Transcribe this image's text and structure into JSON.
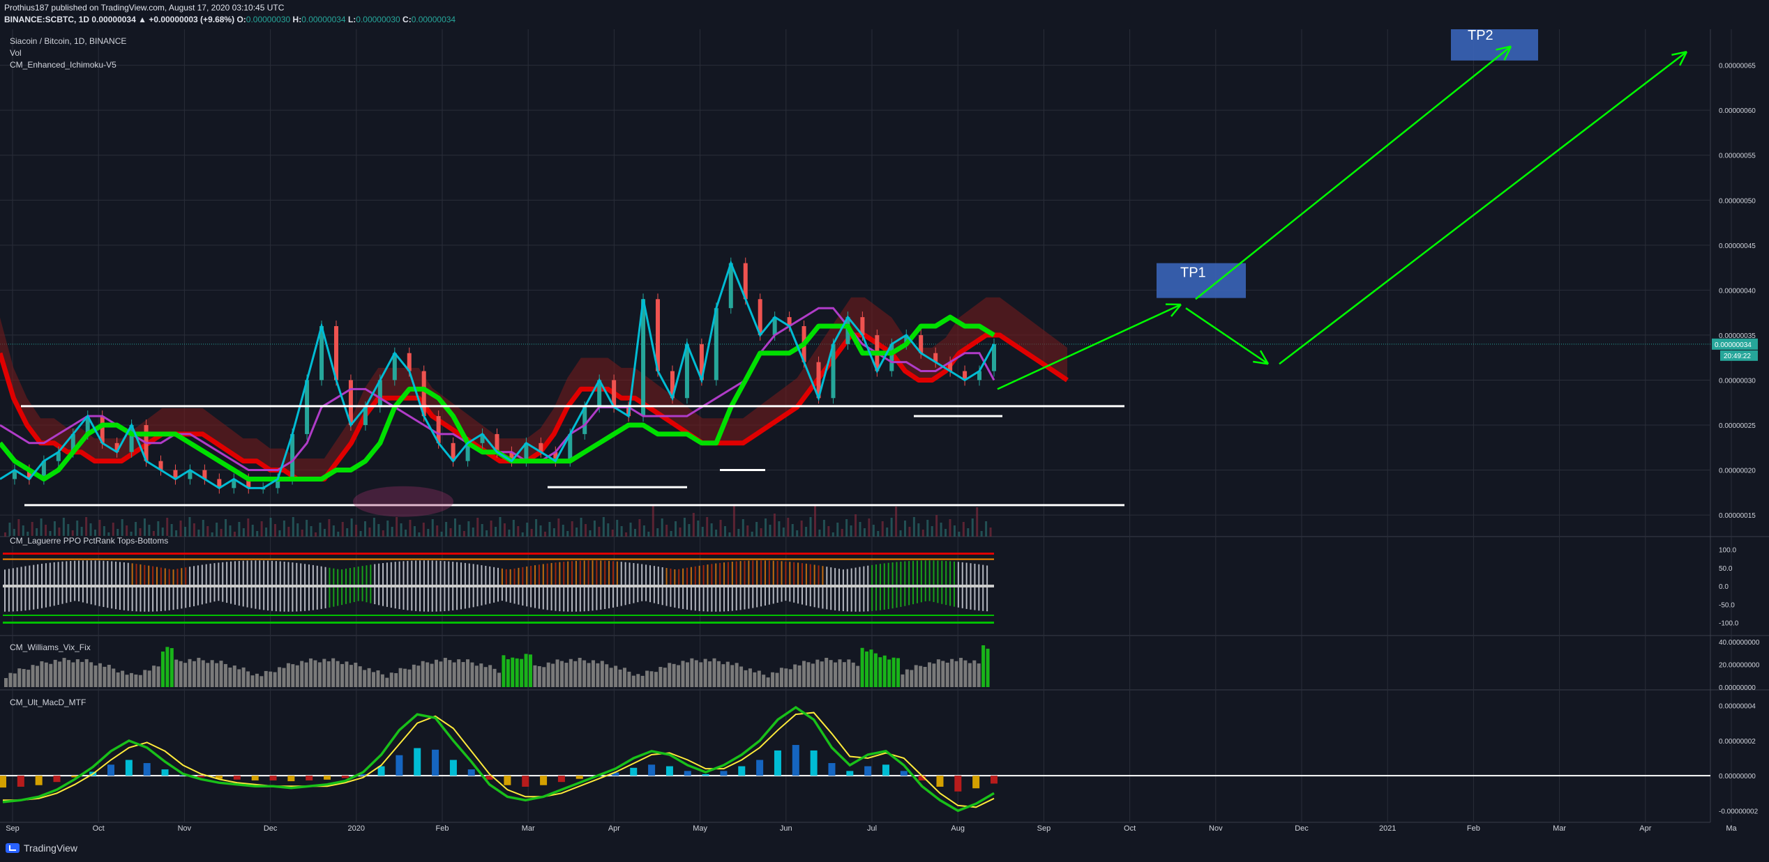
{
  "header": {
    "line1": "Prothius187 published on TradingView.com, August 17, 2020 03:10:45 UTC",
    "symbol": "BINANCE:SCBTC, 1D",
    "price": "0.00000034",
    "change": "▲ +0.00000003 (+9.68%)",
    "o_label": "O:",
    "o": "0.00000030",
    "h_label": "H:",
    "h": "0.00000034",
    "l_label": "L:",
    "l": "0.00000030",
    "c_label": "C:",
    "c": "0.00000034"
  },
  "legend": {
    "title": "Siacoin / Bitcoin, 1D, BINANCE",
    "vol": "Vol",
    "indicator": "CM_Enhanced_Ichimoku-V5"
  },
  "panes": {
    "laguerre": "CM_Laguerre PPO PctRank Tops-Bottoms",
    "vix": "CM_Williams_Vix_Fix",
    "macd": "CM_Ult_MacD_MTF"
  },
  "footer": {
    "brand": "TradingView",
    "icon": "tradingview-logo-icon"
  },
  "colors": {
    "background": "#131722",
    "grid": "#2a2e39",
    "price_line": "#26a69a",
    "tenkan": "#00bcd4",
    "kijun": "#00e000",
    "chikou": "#b03cc8",
    "cloud_bear": "#e00000",
    "annotation": "#00ff00",
    "tp_box": "#3a64b8"
  },
  "chart_data": [
    {
      "type": "line",
      "pane": "price",
      "ylabel": "",
      "ylim": [
        1.4e-07,
        6.9e-07
      ],
      "yticks": [
        "0.00000065",
        "0.00000060",
        "0.00000055",
        "0.00000050",
        "0.00000045",
        "0.00000040",
        "0.00000035",
        "0.00000030",
        "0.00000025",
        "0.00000020",
        "0.00000015"
      ],
      "xticks": [
        "Sep",
        "Oct",
        "Nov",
        "Dec",
        "2020",
        "Feb",
        "Mar",
        "Apr",
        "May",
        "Jun",
        "Jul",
        "Aug",
        "Sep",
        "Oct",
        "Nov",
        "Dec",
        "2021",
        "Feb",
        "Mar",
        "Apr",
        "Ma"
      ],
      "last_price": "0.00000034",
      "countdown": "20:49:22",
      "series": [
        {
          "values": [
            1.9e-07,
            2e-07,
            1.9e-07,
            2.1e-07,
            2.2e-07,
            2.4e-07,
            2.6e-07,
            2.3e-07,
            2.2e-07,
            2.5e-07,
            2.1e-07,
            2e-07,
            1.9e-07,
            2e-07,
            1.9e-07,
            1.8e-07,
            1.9e-07,
            1.8e-07,
            1.8e-07,
            1.9e-07,
            2.4e-07,
            3e-07,
            3.6e-07,
            3e-07,
            2.5e-07,
            2.7e-07,
            3e-07,
            3.3e-07,
            3.1e-07,
            2.6e-07,
            2.3e-07,
            2.1e-07,
            2.3e-07,
            2.4e-07,
            2.2e-07,
            2.1e-07,
            2.3e-07,
            2.2e-07,
            2.1e-07,
            2.4e-07,
            2.7e-07,
            3e-07,
            2.7e-07,
            2.6e-07,
            3.9e-07,
            3.1e-07,
            2.8e-07,
            3.4e-07,
            3e-07,
            3.8e-07,
            4.3e-07,
            3.9e-07,
            3.5e-07,
            3.7e-07,
            3.6e-07,
            3.2e-07,
            2.8e-07,
            3.4e-07,
            3.7e-07,
            3.5e-07,
            3.1e-07,
            3.4e-07,
            3.5e-07,
            3.3e-07,
            3.2e-07,
            3.1e-07,
            3e-07,
            3.1e-07,
            3.4e-07
          ]
        },
        {
          "values": [
            2.3e-07,
            2.1e-07,
            2e-07,
            1.9e-07,
            2e-07,
            2.2e-07,
            2.4e-07,
            2.5e-07,
            2.5e-07,
            2.4e-07,
            2.4e-07,
            2.4e-07,
            2.4e-07,
            2.3e-07,
            2.2e-07,
            2.1e-07,
            2e-07,
            1.9e-07,
            1.9e-07,
            1.9e-07,
            1.9e-07,
            1.9e-07,
            1.9e-07,
            2e-07,
            2e-07,
            2.1e-07,
            2.3e-07,
            2.7e-07,
            2.9e-07,
            2.9e-07,
            2.8e-07,
            2.6e-07,
            2.3e-07,
            2.2e-07,
            2.2e-07,
            2.1e-07,
            2.1e-07,
            2.1e-07,
            2.1e-07,
            2.1e-07,
            2.2e-07,
            2.3e-07,
            2.4e-07,
            2.5e-07,
            2.5e-07,
            2.4e-07,
            2.4e-07,
            2.4e-07,
            2.3e-07,
            2.3e-07,
            2.7e-07,
            3e-07,
            3.3e-07,
            3.3e-07,
            3.3e-07,
            3.4e-07,
            3.6e-07,
            3.6e-07,
            3.6e-07,
            3.3e-07,
            3.3e-07,
            3.3e-07,
            3.4e-07,
            3.6e-07,
            3.6e-07,
            3.7e-07,
            3.6e-07,
            3.6e-07,
            3.5e-07
          ]
        },
        {
          "values": [
            2.5e-07,
            2.4e-07,
            2.3e-07,
            2.3e-07,
            2.4e-07,
            2.5e-07,
            2.6e-07,
            2.6e-07,
            2.5e-07,
            2.4e-07,
            2.3e-07,
            2.3e-07,
            2.4e-07,
            2.4e-07,
            2.3e-07,
            2.2e-07,
            2.1e-07,
            2e-07,
            2e-07,
            2e-07,
            2.1e-07,
            2.3e-07,
            2.7e-07,
            2.8e-07,
            2.9e-07,
            2.9e-07,
            2.8e-07,
            2.7e-07,
            2.6e-07,
            2.5e-07,
            2.4e-07,
            2.4e-07,
            2.3e-07,
            2.2e-07,
            2.2e-07,
            2.2e-07,
            2.1e-07,
            2.1e-07,
            2.2e-07,
            2.4e-07,
            2.5e-07,
            2.7e-07,
            2.7e-07,
            2.7e-07,
            2.6e-07,
            2.6e-07,
            2.6e-07,
            2.6e-07,
            2.7e-07,
            2.8e-07,
            2.9e-07,
            3e-07,
            3.3e-07,
            3.5e-07,
            3.6e-07,
            3.7e-07,
            3.8e-07,
            3.8e-07,
            3.6e-07,
            3.4e-07,
            3.3e-07,
            3.2e-07,
            3.2e-07,
            3.1e-07,
            3.1e-07,
            3.2e-07,
            3.3e-07,
            3.3e-07,
            3e-07
          ]
        },
        {
          "values": [
            3.3e-07,
            2.8e-07,
            2.5e-07,
            2.3e-07,
            2.3e-07,
            2.2e-07,
            2.2e-07,
            2.1e-07,
            2.1e-07,
            2.1e-07,
            2.2e-07,
            2.3e-07,
            2.4e-07,
            2.4e-07,
            2.4e-07,
            2.4e-07,
            2.3e-07,
            2.2e-07,
            2.1e-07,
            2.1e-07,
            2e-07,
            2e-07,
            1.9e-07,
            1.9e-07,
            1.9e-07,
            2.1e-07,
            2.3e-07,
            2.6e-07,
            2.8e-07,
            2.8e-07,
            2.8e-07,
            2.8e-07,
            2.6e-07,
            2.5e-07,
            2.4e-07,
            2.3e-07,
            2.2e-07,
            2.1e-07,
            2.1e-07,
            2.1e-07,
            2.2e-07,
            2.4e-07,
            2.7e-07,
            2.9e-07,
            2.9e-07,
            2.9e-07,
            2.8e-07,
            2.8e-07,
            2.7e-07,
            2.6e-07,
            2.5e-07,
            2.4e-07,
            2.3e-07,
            2.3e-07,
            2.3e-07,
            2.3e-07,
            2.4e-07,
            2.5e-07,
            2.6e-07,
            2.7e-07,
            2.9e-07,
            3.1e-07,
            3.3e-07,
            3.5e-07,
            3.5e-07,
            3.4e-07,
            3.3e-07,
            3.1e-07,
            3e-07,
            3e-07,
            3.1e-07,
            3.3e-07,
            3.4e-07,
            3.5e-07,
            3.5e-07,
            3.4e-07,
            3.3e-07,
            3.2e-07,
            3.1e-07,
            3e-07
          ]
        }
      ],
      "annotations": {
        "tp1_label": "TP1",
        "tp2_label": "TP2"
      }
    },
    {
      "type": "bar",
      "pane": "laguerre",
      "ylim": [
        -120,
        120
      ],
      "yticks": [
        "100.0",
        "50.0",
        "0.0",
        "-50.0",
        "-100.0"
      ]
    },
    {
      "type": "bar",
      "pane": "vix",
      "ylim": [
        0,
        42
      ],
      "yticks": [
        "40.00000000",
        "20.00000000",
        "0.00000000"
      ]
    },
    {
      "type": "line",
      "pane": "macd",
      "ylim": [
        -2.5e-08,
        4.5e-08
      ],
      "yticks": [
        "0.00000004",
        "0.00000002",
        "0.00000000",
        "-0.00000002"
      ],
      "series": [
        {
          "values": [
            -1.5e-08,
            -1.4e-08,
            -1.2e-08,
            -8e-09,
            -2e-09,
            5e-09,
            1.4e-08,
            2e-08,
            1.6e-08,
            8e-09,
            1e-09,
            -2e-09,
            -4e-09,
            -5e-09,
            -6e-09,
            -6e-09,
            -7e-09,
            -6e-09,
            -5e-09,
            -3e-09,
            2e-09,
            1.2e-08,
            2.6e-08,
            3.5e-08,
            3.3e-08,
            2e-08,
            8e-09,
            -5e-09,
            -1.2e-08,
            -1.4e-08,
            -1.2e-08,
            -8e-09,
            -4e-09,
            0.0,
            4e-09,
            1e-08,
            1.4e-08,
            1.2e-08,
            6e-09,
            2e-09,
            6e-09,
            1.2e-08,
            2e-08,
            3.2e-08,
            3.9e-08,
            3.2e-08,
            1.6e-08,
            6e-09,
            1.2e-08,
            1.4e-08,
            6e-09,
            -6e-09,
            -1.4e-08,
            -2e-08,
            -1.6e-08,
            -1e-08
          ]
        },
        {
          "values": [
            -1.4e-08,
            -1.4e-08,
            -1.3e-08,
            -1e-08,
            -5e-09,
            1e-09,
            9e-09,
            1.6e-08,
            1.9e-08,
            1.4e-08,
            6e-09,
            1e-09,
            -2e-09,
            -4e-09,
            -5e-09,
            -6e-09,
            -6e-09,
            -6e-09,
            -6e-09,
            -4e-09,
            -1e-09,
            6e-09,
            1.8e-08,
            3e-08,
            3.4e-08,
            2.7e-08,
            1.4e-08,
            1e-09,
            -8e-09,
            -1.2e-08,
            -1.2e-08,
            -1e-08,
            -6e-09,
            -2e-09,
            2e-09,
            7e-09,
            1.2e-08,
            1.3e-08,
            9e-09,
            4e-09,
            4e-09,
            9e-09,
            1.6e-08,
            2.6e-08,
            3.5e-08,
            3.6e-08,
            2.4e-08,
            1.1e-08,
            1e-08,
            1.3e-08,
            1e-08,
            0.0,
            -1e-08,
            -1.7e-08,
            -1.8e-08,
            -1.3e-08
          ]
        }
      ]
    }
  ]
}
